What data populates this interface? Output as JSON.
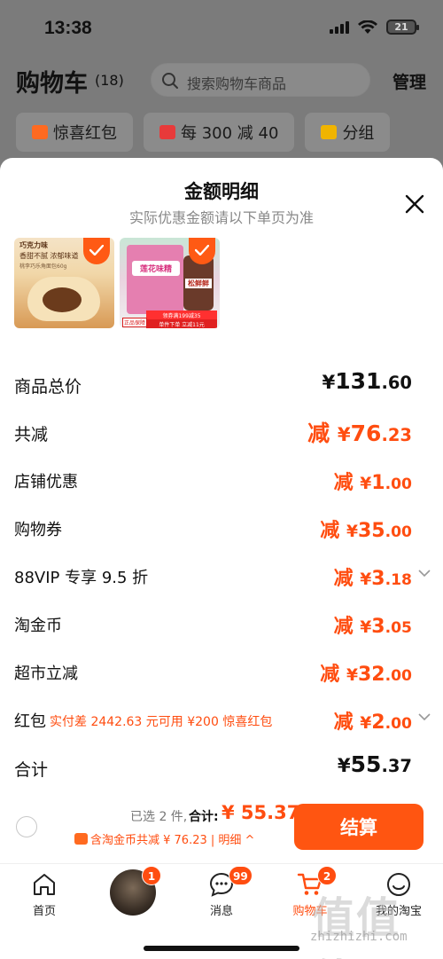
{
  "status_bar": {
    "time": "13:38",
    "battery": "21"
  },
  "cart_header": {
    "title": "购物车",
    "count": "(18)",
    "search_placeholder": "搜索购物车商品",
    "manage_label": "管理"
  },
  "chips": [
    {
      "label": "惊喜红包",
      "icon": "red-envelope-icon",
      "color": "#ff6a20"
    },
    {
      "label": "每 300 减 40",
      "icon": "coupon-icon",
      "color": "#e83a3a"
    },
    {
      "label": "分组",
      "icon": "folder-icon",
      "color": "#f0b400"
    }
  ],
  "sheet": {
    "title": "金额明细",
    "subtitle": "实际优惠金额请以下单页为准",
    "products": [
      {
        "line1": "巧克力味",
        "line2": "香甜不腻 浓郁味道",
        "line3": "桃李巧乐角面包60g"
      },
      {
        "name": "莲花味精",
        "jar": "松鲜鲜",
        "badge1": "领券满199减35",
        "badge2": "单件下单 立减11元",
        "genuine": "正品保障"
      }
    ],
    "rows": [
      {
        "label": "商品总价",
        "yen": "¥",
        "int": "131",
        "frac": ".60",
        "prefix": ""
      },
      {
        "label": "共减",
        "yen": "¥",
        "int": "76",
        "frac": ".23",
        "prefix": "减 "
      },
      {
        "label": "店铺优惠",
        "yen": "¥",
        "int": "1",
        "frac": ".00",
        "prefix": "减 "
      },
      {
        "label": "购物券",
        "yen": "¥",
        "int": "35",
        "frac": ".00",
        "prefix": "减 "
      },
      {
        "label": "88VIP 专享 9.5 折",
        "yen": "¥",
        "int": "3",
        "frac": ".18",
        "prefix": "减 "
      },
      {
        "label": "淘金币",
        "yen": "¥",
        "int": "3",
        "frac": ".05",
        "prefix": "减 "
      },
      {
        "label": "超市立减",
        "yen": "¥",
        "int": "32",
        "frac": ".00",
        "prefix": "减 "
      },
      {
        "label": "红包",
        "hint": "实付差 2442.63 元可用 ¥200 惊喜红包",
        "yen": "¥",
        "int": "2",
        "frac": ".00",
        "prefix": "减 "
      },
      {
        "label": "合计",
        "yen": "¥",
        "int": "55",
        "frac": ".37",
        "prefix": ""
      }
    ]
  },
  "checkout": {
    "selected_text": "已选 2 件,",
    "total_label": "合计:",
    "total_value": "¥ 55.37",
    "discount_text": "含淘金币共减 ¥ 76.23 | 明细 ^",
    "pay_label": "结算"
  },
  "tabbar": [
    {
      "label": "首页",
      "icon": "home-icon",
      "badge": ""
    },
    {
      "label": "",
      "icon": "avatar",
      "badge": "1"
    },
    {
      "label": "消息",
      "icon": "message-icon",
      "badge": "99"
    },
    {
      "label": "购物车",
      "icon": "cart-icon",
      "badge": "2"
    },
    {
      "label": "我的淘宝",
      "icon": "profile-icon",
      "badge": ""
    }
  ],
  "watermark": {
    "text": "值值值",
    "url": "zhizhizhi.com"
  },
  "colors": {
    "accent": "#ff4d10",
    "button": "#ff5511"
  }
}
